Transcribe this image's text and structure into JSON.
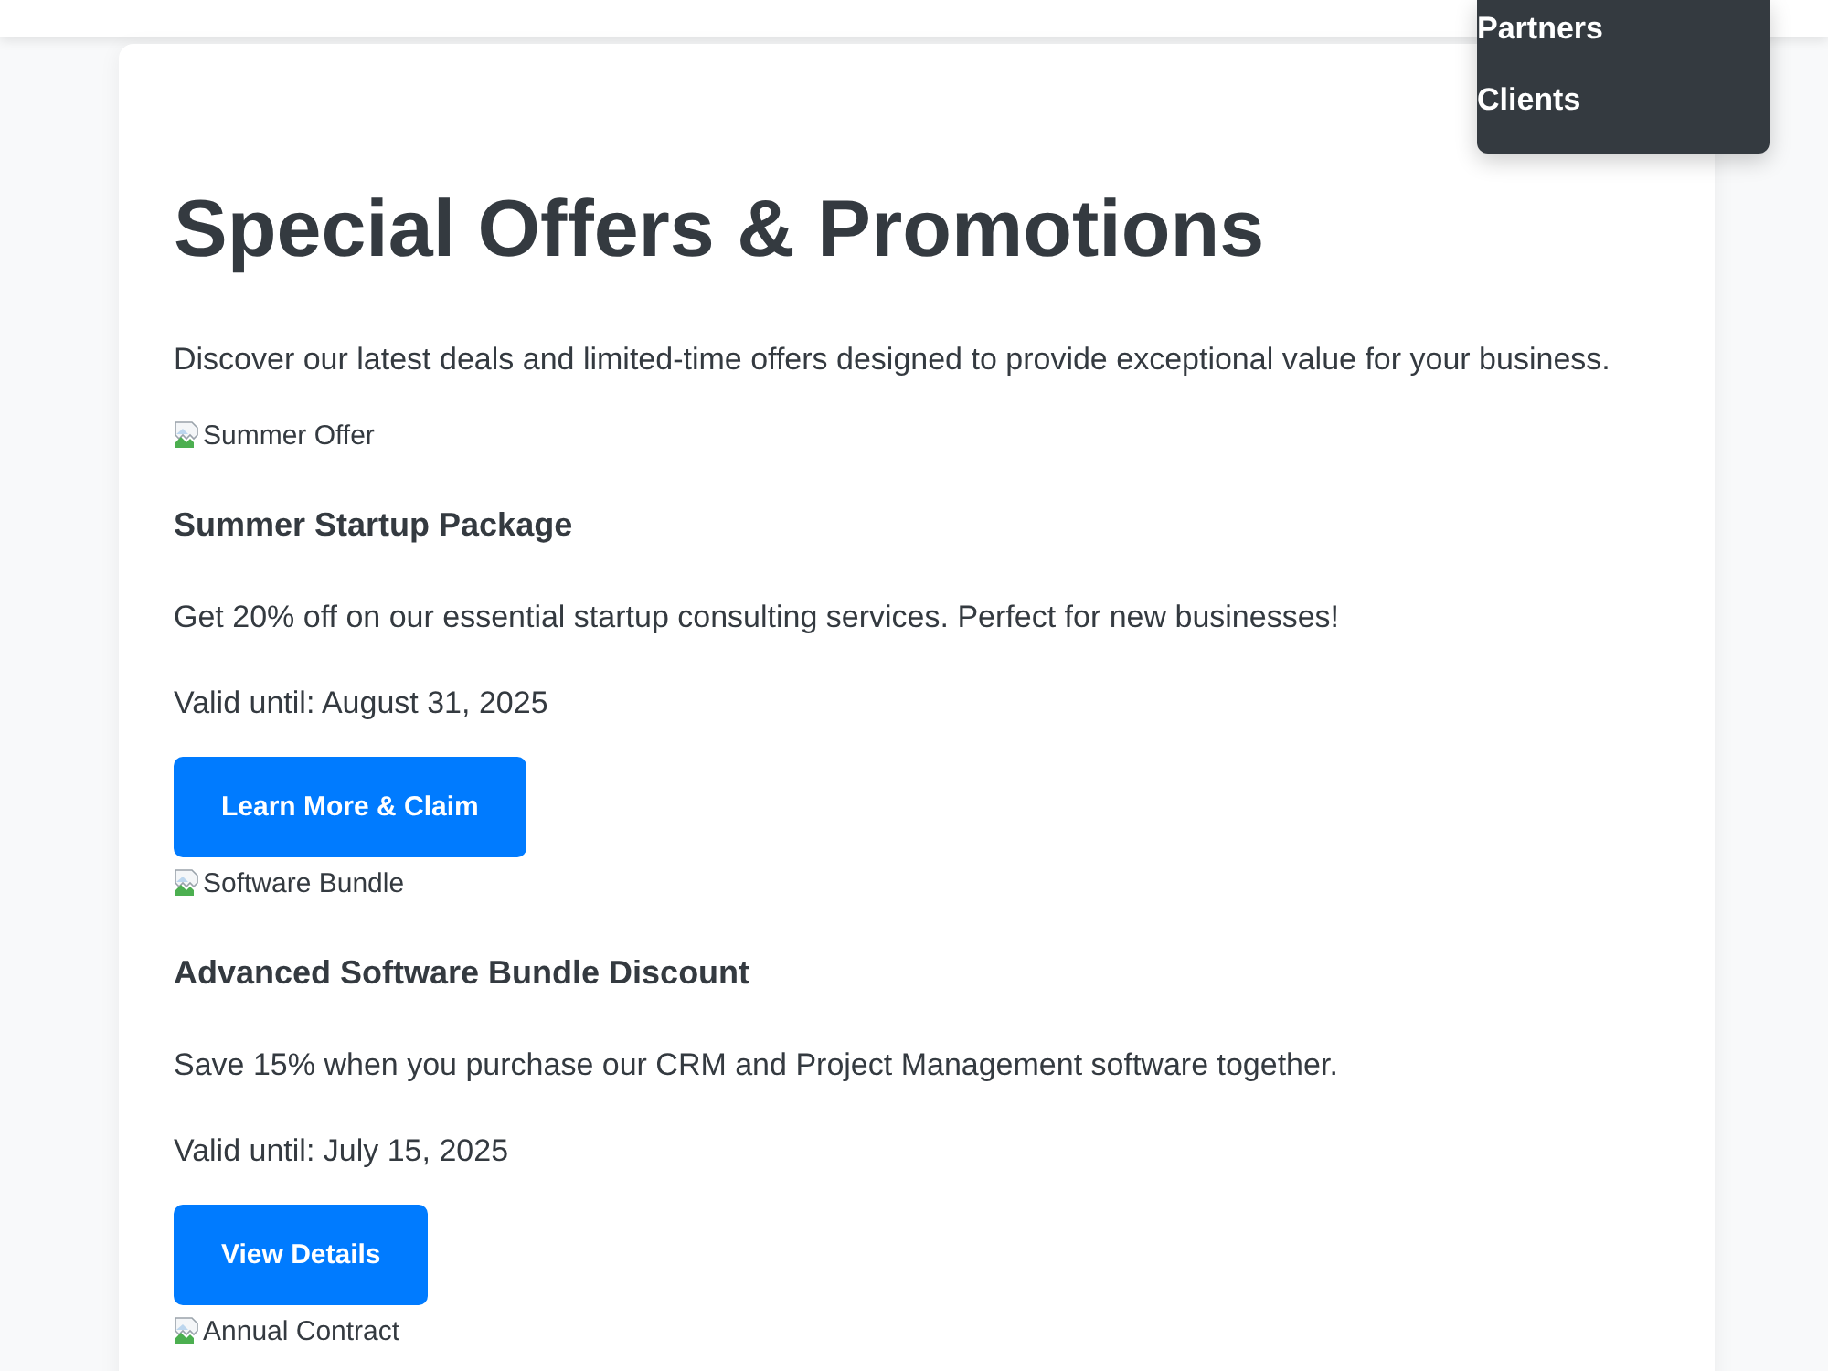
{
  "dropdown_menu": {
    "items": [
      {
        "label": "Partners"
      },
      {
        "label": "Clients"
      }
    ]
  },
  "page": {
    "title": "Special Offers & Promotions",
    "intro": "Discover our latest deals and limited-time offers designed to provide exceptional value for your business."
  },
  "offers": [
    {
      "image_alt": "Summer Offer",
      "title": "Summer Startup Package",
      "description": "Get 20% off on our essential startup consulting services. Perfect for new businesses!",
      "validity": "Valid until: August 31, 2025",
      "button": "Learn More & Claim"
    },
    {
      "image_alt": "Software Bundle",
      "title": "Advanced Software Bundle Discount",
      "description": "Save 15% when you purchase our CRM and Project Management software together.",
      "validity": "Valid until: July 15, 2025",
      "button": "View Details"
    },
    {
      "image_alt": "Annual Contract"
    }
  ]
}
